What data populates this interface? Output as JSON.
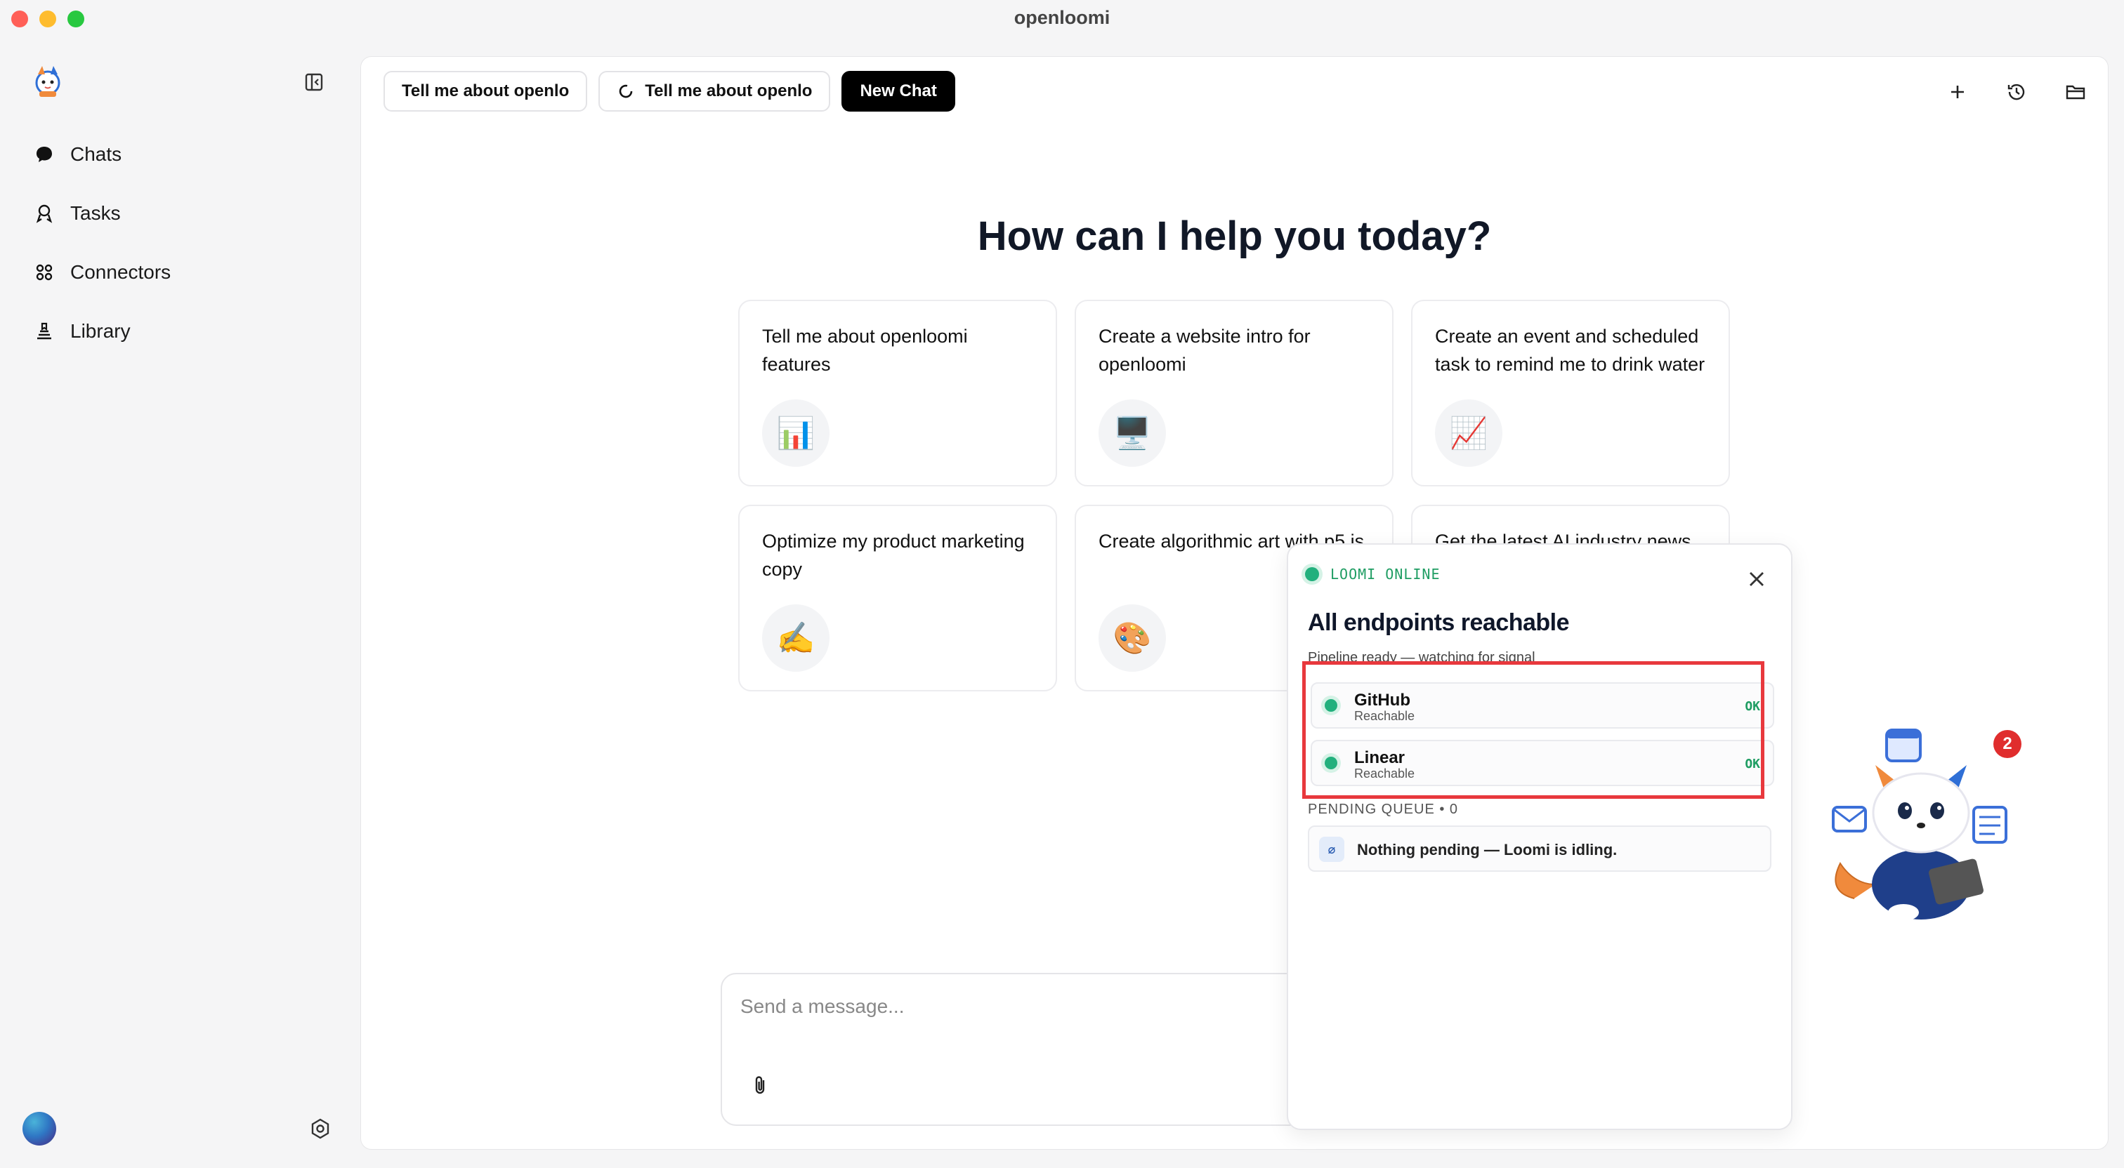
{
  "window": {
    "title": "openloomi"
  },
  "sidebar": {
    "items": [
      {
        "label": "Chats",
        "icon": "chat-bubble-icon"
      },
      {
        "label": "Tasks",
        "icon": "tasks-icon"
      },
      {
        "label": "Connectors",
        "icon": "connectors-icon"
      },
      {
        "label": "Library",
        "icon": "library-icon"
      }
    ]
  },
  "tabs": [
    {
      "label": "Tell me about openlo",
      "icon": null
    },
    {
      "label": "Tell me about openlo",
      "icon": "refresh-icon"
    },
    {
      "label": "New Chat",
      "active": true
    }
  ],
  "header_actions": [
    "plus-icon",
    "history-icon",
    "folder-icon"
  ],
  "main": {
    "heading": "How can I help you today?",
    "suggestions": [
      {
        "text": "Tell me about openloomi features",
        "emoji": "📊"
      },
      {
        "text": "Create a website intro for openloomi",
        "emoji": "🖥️"
      },
      {
        "text": "Create an event and scheduled task to remind me to drink water",
        "emoji": "📈"
      },
      {
        "text": "Optimize my product marketing copy",
        "emoji": "✍️"
      },
      {
        "text": "Create algorithmic art with p5.js",
        "emoji": "🎨"
      },
      {
        "text": "Get the latest AI industry news",
        "emoji": ""
      }
    ]
  },
  "composer": {
    "placeholder": "Send a message..."
  },
  "status_panel": {
    "online_label": "LOOMI ONLINE",
    "title": "All endpoints reachable",
    "subtitle": "Pipeline ready — watching for signal",
    "endpoints": [
      {
        "name": "GitHub",
        "status": "Reachable",
        "ok": "OK"
      },
      {
        "name": "Linear",
        "status": "Reachable",
        "ok": "OK"
      }
    ],
    "queue_label": "PENDING QUEUE • 0",
    "queue_empty_text": "Nothing pending — Loomi is idling.",
    "queue_icon": "⌀"
  },
  "mascot": {
    "notification_count": "2"
  },
  "colors": {
    "accent_green": "#22b07d",
    "highlight_red": "#e8383d",
    "badge_red": "#e02d2d"
  }
}
